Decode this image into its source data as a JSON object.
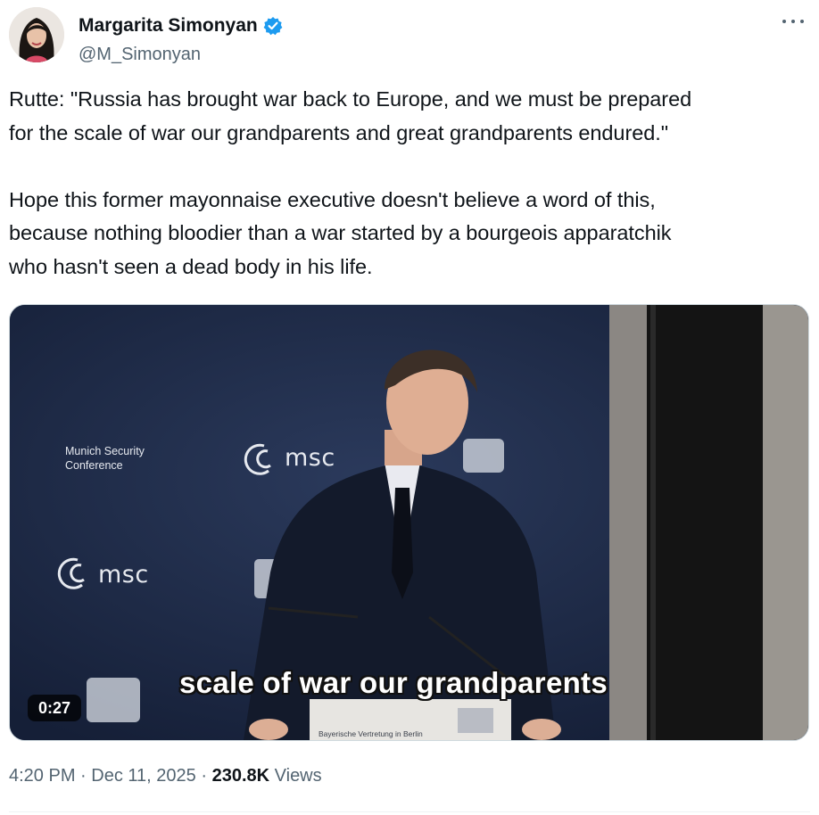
{
  "author": {
    "display_name": "Margarita Simonyan",
    "handle": "@M_Simonyan",
    "verified": true,
    "verified_color": "#1d9bf0"
  },
  "more_menu": {
    "icon": "more-horizontal-icon"
  },
  "tweet": {
    "text": "Rutte: \"Russia has brought war back to Europe, and we must be prepared\nfor the scale of war our grandparents and great grandparents endured.\"\n\nHope this former mayonnaise executive doesn't believe a word of this,\nbecause nothing bloodier than a war started by a bourgeois apparatchik\nwho hasn't seen a dead body in his life."
  },
  "video": {
    "caption": "scale of war our grandparents",
    "duration": "0:27",
    "backdrop_text": {
      "conference_line1": "Munich Security",
      "conference_line2": "Conference",
      "logo_text": "msc",
      "podium_label": "Bayerische Vertretung in Berlin"
    }
  },
  "meta": {
    "time": "4:20 PM",
    "separator": "·",
    "date": "Dec 11, 2025",
    "views_count": "230.8K",
    "views_label": "Views"
  }
}
